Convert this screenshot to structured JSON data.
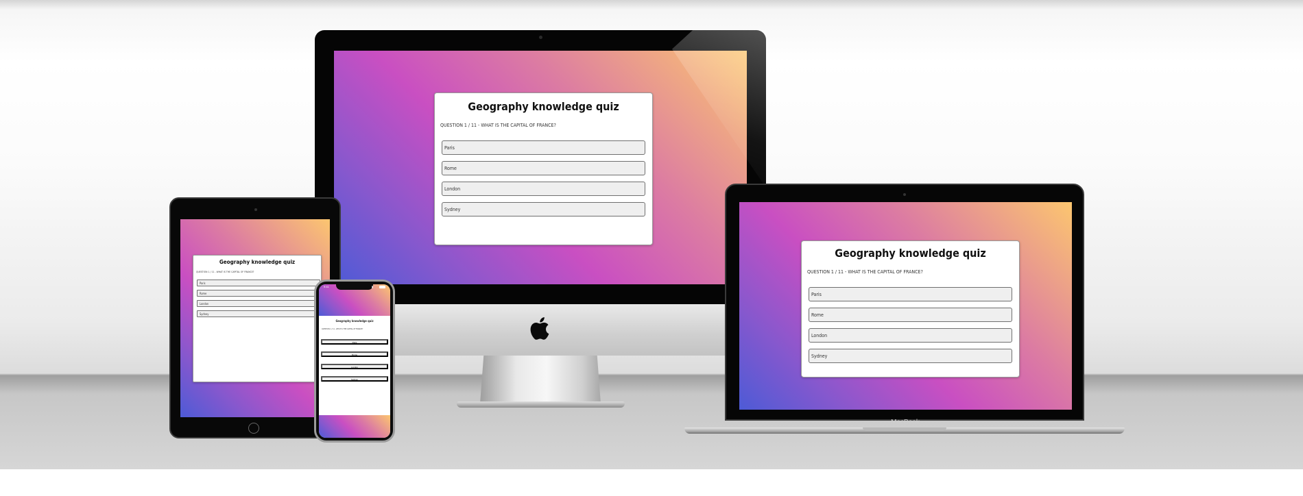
{
  "quiz": {
    "title": "Geography knowledge quiz",
    "question": "QUESTION 1 / 11 - WHAT IS THE CAPITAL OF FRANCE?",
    "answers": [
      "Paris",
      "Rome",
      "London",
      "Sydney"
    ]
  },
  "devices": {
    "laptop_label": "MacBook",
    "phone_time": "9:41"
  },
  "colors": {
    "gradient_start": "#4d5bd6",
    "gradient_mid": "#c94fc2",
    "gradient_end": "#fcc66f",
    "card_background": "#ffffff",
    "answer_background": "#efefef"
  },
  "icons": [
    "apple-logo-icon",
    "camera-icon",
    "home-button-icon",
    "battery-icon",
    "signal-icon"
  ]
}
